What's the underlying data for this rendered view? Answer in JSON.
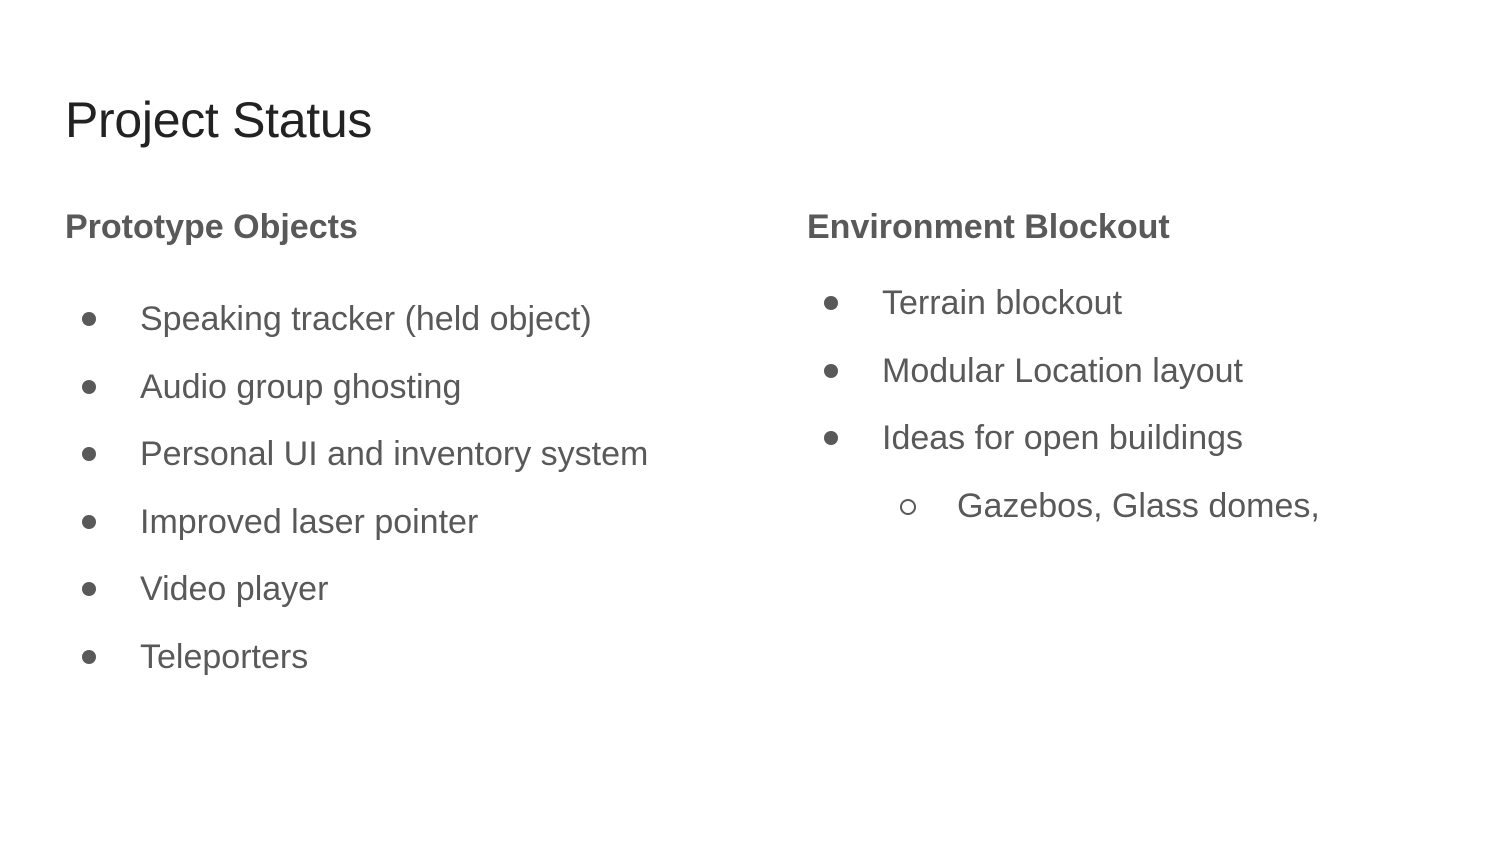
{
  "slide": {
    "title": "Project Status",
    "left_column": {
      "heading": "Prototype Objects",
      "items": [
        "Speaking tracker (held object)",
        "Audio group ghosting",
        "Personal UI and inventory system",
        "Improved laser pointer",
        "Video player",
        "Teleporters"
      ]
    },
    "right_column": {
      "heading": "Environment Blockout",
      "items": [
        "Terrain blockout",
        "Modular Location layout",
        "Ideas for open buildings"
      ],
      "sub_items": [
        "Gazebos, Glass domes,"
      ]
    },
    "colors": {
      "title": "#222222",
      "body_text": "#595959",
      "background": "#ffffff"
    }
  }
}
